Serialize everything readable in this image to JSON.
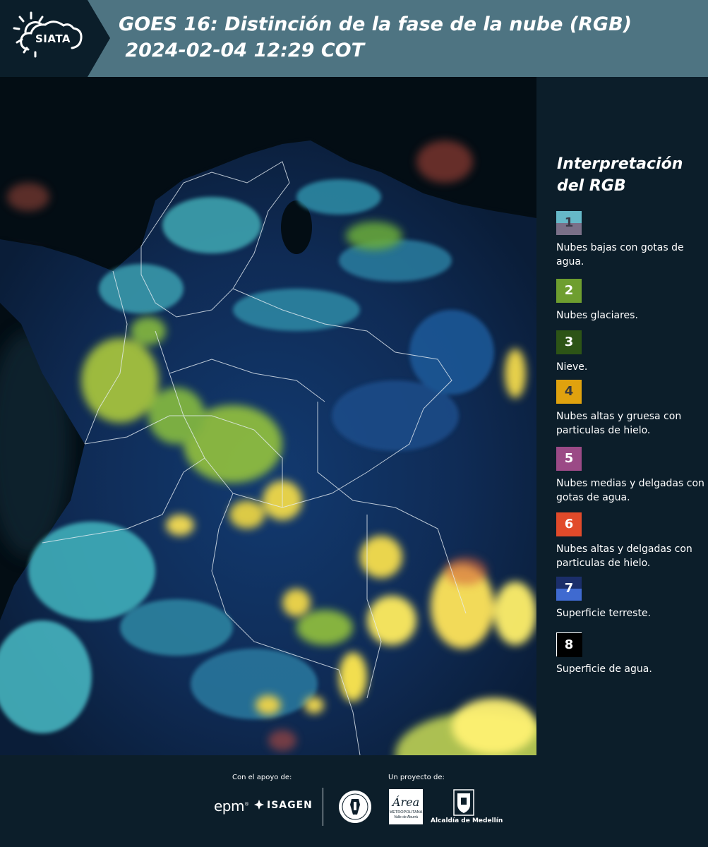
{
  "header": {
    "logo_text": "SIATA",
    "title_line1": "GOES 16: Distinción de la fase de la nube (RGB)",
    "title_line2": " 2024-02-04 12:29 COT"
  },
  "legend": {
    "title": "Interpretación del RGB",
    "items": [
      {
        "number": "1",
        "color_top": "#66b8c8",
        "color_bottom": "#7a7088",
        "label": "Nubes bajas con gotas de agua."
      },
      {
        "number": "2",
        "color_top": "#6e9e2f",
        "color_bottom": "#6e9e2f",
        "label": "Nubes glaciares."
      },
      {
        "number": "3",
        "color_top": "#2d5416",
        "color_bottom": "#2d5416",
        "label": "Nieve."
      },
      {
        "number": "4",
        "color_top": "#e0a20e",
        "color_bottom": "#e0a20e",
        "label": "Nubes altas y gruesa con particulas de hielo."
      },
      {
        "number": "5",
        "color_top": "#9b4a86",
        "color_bottom": "#9b4a86",
        "label": "Nubes medias y delgadas con gotas de agua."
      },
      {
        "number": "6",
        "color_top": "#e14a2a",
        "color_bottom": "#e14a2a",
        "label": "Nubes altas y delgadas con particulas de hielo."
      },
      {
        "number": "7",
        "color_top": "#1b2e6a",
        "color_bottom": "#3f6ad0",
        "label": "Superficie terreste."
      },
      {
        "number": "8",
        "color_top": "#000000",
        "color_bottom": "#000000",
        "label": "Superficie de agua."
      }
    ]
  },
  "footer": {
    "support_label": "Con el apoyo de:",
    "project_label": "Un proyecto de:",
    "epm": "epm",
    "isagen": "ISAGEN",
    "area_script": "Área",
    "area_sub1": "METROPOLITANA",
    "area_sub2": "Valle de Aburrá",
    "alcaldia": "Alcaldía de Medellín"
  }
}
